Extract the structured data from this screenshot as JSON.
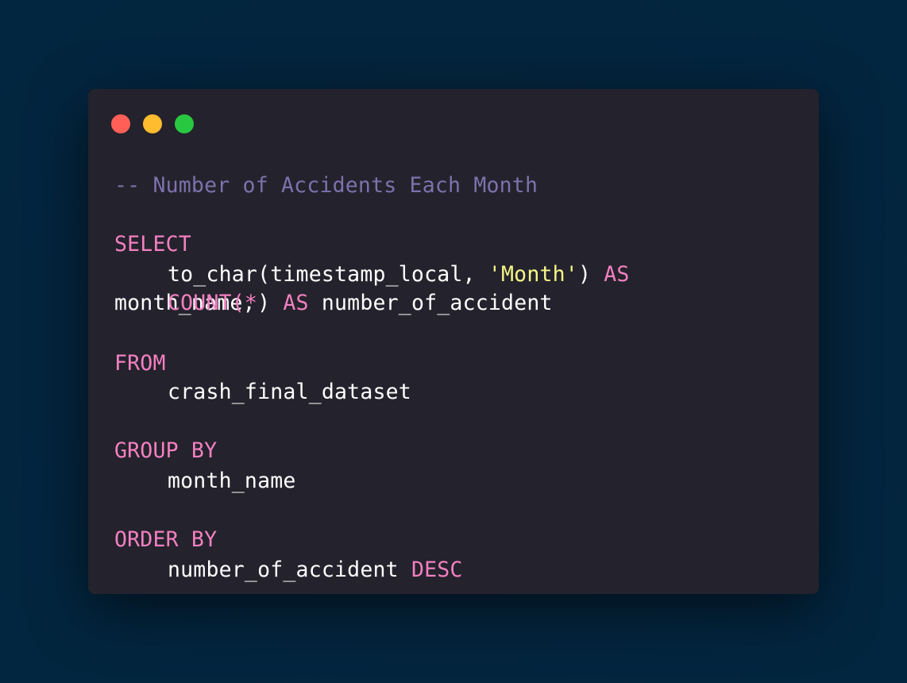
{
  "window": {
    "controls": [
      {
        "name": "close",
        "color": "#ff5f57"
      },
      {
        "name": "minimize",
        "color": "#febc2e"
      },
      {
        "name": "zoom",
        "color": "#28c840"
      }
    ]
  },
  "colors": {
    "background": "#03263f",
    "editor": "#24222c",
    "comment": "#7d72ad",
    "keyword": "#f380c1",
    "string": "#f6f687",
    "text": "#ffffff"
  },
  "code": {
    "comment": "-- Number of Accidents Each Month",
    "select_kw": "SELECT",
    "l1_fn": "to_char(timestamp_local, ",
    "l1_str": "'Month'",
    "l1_close": ") ",
    "l1_as": "AS",
    "l2_wrap": "month_name,",
    "l3_count": "COUNT(*",
    "l3_close": ") ",
    "l3_as": "AS",
    "l3_alias": " number_of_accident",
    "from_kw": "FROM",
    "from_table": "crash_final_dataset",
    "group_kw": "GROUP BY",
    "group_col": "month_name",
    "order_kw": "ORDER BY",
    "order_col": "number_of_accident ",
    "order_dir": "DESC"
  }
}
